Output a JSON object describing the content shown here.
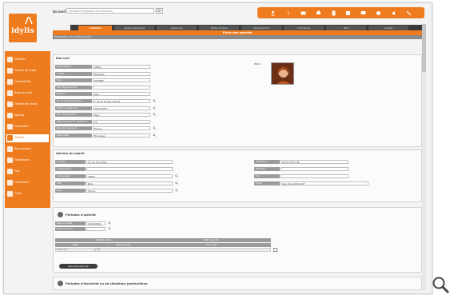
{
  "app": {
    "logo_text": "idylis"
  },
  "search": {
    "label": "Accueil",
    "placeholder": "Contacts Prospects Fournisseurs"
  },
  "tabs": [
    {
      "label": "Contacts"
    },
    {
      "label": "Gestion de projet"
    },
    {
      "label": "Absences"
    },
    {
      "label": "Notes de frais"
    },
    {
      "label": "Recrutement"
    },
    {
      "label": "Formations"
    },
    {
      "label": "Paie"
    },
    {
      "label": "Achats"
    }
  ],
  "subtitle": "Fiche des salariés",
  "mod_bar": "Modification de la fiche salarié",
  "sidebar": [
    {
      "label": "Contacts"
    },
    {
      "label": "Gestion de projet"
    },
    {
      "label": "Comptabilité"
    },
    {
      "label": "Notes de frais"
    },
    {
      "label": "Gestion de stocks"
    },
    {
      "label": "Agenda"
    },
    {
      "label": "Facturation"
    },
    {
      "label": "Salariés",
      "active": true
    },
    {
      "label": "Recrutement"
    },
    {
      "label": "Statistiques"
    },
    {
      "label": "Paie"
    },
    {
      "label": "Formations"
    },
    {
      "label": "Outils"
    }
  ],
  "civil": {
    "title": "Etat civil",
    "rows": [
      {
        "label": "Code salarié",
        "value": "S0001"
      },
      {
        "label": "Civilité",
        "value": "Monsieur"
      },
      {
        "label": "Nom",
        "value": "DUPONT"
      },
      {
        "label": "Nom de jeune fille",
        "value": ""
      },
      {
        "label": "Prénom",
        "value": "Jean"
      },
      {
        "label": "N° de sécurité sociale",
        "value": "1 75 07 75 012 123 45"
      },
      {
        "label": "Date de naissance",
        "value": "07/07/1975"
      },
      {
        "label": "Lieu de naissance",
        "value": "Paris"
      },
      {
        "label": "Département de naissance",
        "value": "75"
      },
      {
        "label": "Pays de naissance",
        "value": "France"
      },
      {
        "label": "Nationalité",
        "value": "Française"
      }
    ],
    "photo_label": "Photo"
  },
  "address": {
    "title": "Adresse du salarié",
    "left": [
      {
        "label": "Adresse",
        "value": "12 rue de la Paix"
      },
      {
        "label": "Complément",
        "value": ""
      },
      {
        "label": "Code postal",
        "value": "75002"
      },
      {
        "label": "Ville",
        "value": "Paris"
      },
      {
        "label": "Pays",
        "value": "France"
      }
    ],
    "right": [
      {
        "label": "Téléphone",
        "value": "01 23 45 67 89"
      },
      {
        "label": "Portable",
        "value": ""
      },
      {
        "label": "Fax",
        "value": ""
      },
      {
        "label": "Email",
        "value": "jean.dupont@mail.fr"
      }
    ]
  },
  "absences": {
    "title": "Périodes d'activité",
    "rows": [
      {
        "label": "Date d'entrée",
        "value": "01/01/2010"
      },
      {
        "label": "Date de sortie",
        "value": ""
      }
    ],
    "table_headers": [
      "Motif de sortie",
      "Motif de sortie",
      "Motif",
      "Date de sortie",
      "Code motif"
    ],
    "table_row": [
      "Démission",
      "Oui"
    ],
    "button_label": "Nouvelle période"
  },
  "footer_section": {
    "title": "Périodes d'inactivité ou de situations particulières"
  },
  "colors": {
    "accent": "#ee7c1e",
    "dark": "#3a3a3a",
    "label_bg": "#9b9b9b"
  }
}
